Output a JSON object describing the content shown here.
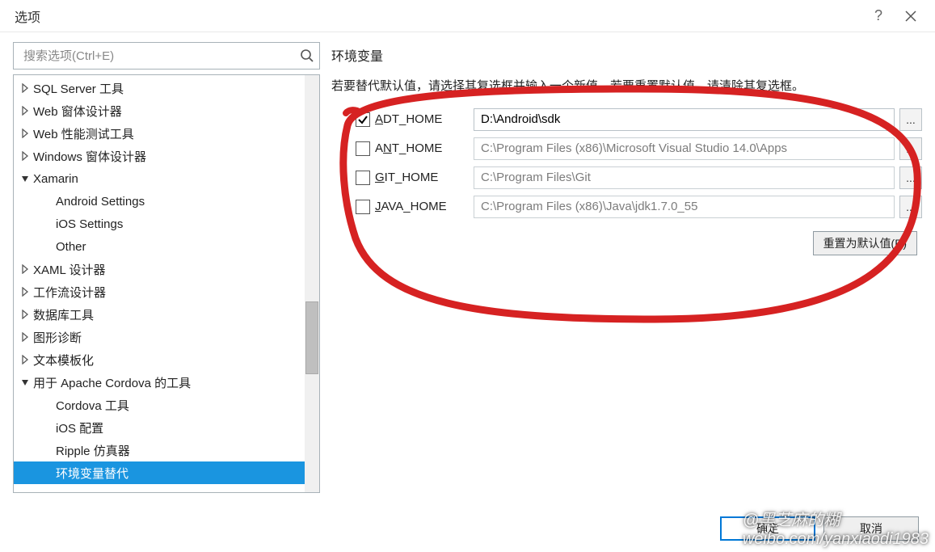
{
  "title": "选项",
  "search": {
    "placeholder": "搜索选项(Ctrl+E)"
  },
  "tree": {
    "items": [
      {
        "indent": 1,
        "arrow": "right",
        "label": "SQL Server 工具"
      },
      {
        "indent": 1,
        "arrow": "right",
        "label": "Web 窗体设计器"
      },
      {
        "indent": 1,
        "arrow": "right",
        "label": "Web 性能测试工具"
      },
      {
        "indent": 1,
        "arrow": "right",
        "label": "Windows 窗体设计器"
      },
      {
        "indent": 1,
        "arrow": "down",
        "label": "Xamarin"
      },
      {
        "indent": 2,
        "arrow": "",
        "label": "Android Settings"
      },
      {
        "indent": 2,
        "arrow": "",
        "label": "iOS Settings"
      },
      {
        "indent": 2,
        "arrow": "",
        "label": "Other"
      },
      {
        "indent": 1,
        "arrow": "right",
        "label": "XAML 设计器"
      },
      {
        "indent": 1,
        "arrow": "right",
        "label": "工作流设计器"
      },
      {
        "indent": 1,
        "arrow": "right",
        "label": "数据库工具"
      },
      {
        "indent": 1,
        "arrow": "right",
        "label": "图形诊断"
      },
      {
        "indent": 1,
        "arrow": "right",
        "label": "文本模板化"
      },
      {
        "indent": 1,
        "arrow": "down",
        "label": "用于 Apache Cordova 的工具"
      },
      {
        "indent": 2,
        "arrow": "",
        "label": "Cordova 工具"
      },
      {
        "indent": 2,
        "arrow": "",
        "label": "iOS 配置"
      },
      {
        "indent": 2,
        "arrow": "",
        "label": "Ripple 仿真器"
      },
      {
        "indent": 2,
        "arrow": "",
        "label": "环境变量替代",
        "selected": true
      }
    ]
  },
  "panel": {
    "title": "环境变量",
    "help": "若要替代默认值，请选择其复选框并输入一个新值。若要重置默认值，请清除其复选框。",
    "rows": [
      {
        "checked": true,
        "name_pre": "",
        "name_u": "A",
        "name_post": "DT_HOME",
        "value": "D:\\Android\\sdk",
        "dim": false
      },
      {
        "checked": false,
        "name_pre": "A",
        "name_u": "N",
        "name_post": "T_HOME",
        "value": "C:\\Program Files (x86)\\Microsoft Visual Studio 14.0\\Apps",
        "dim": true
      },
      {
        "checked": false,
        "name_pre": "",
        "name_u": "G",
        "name_post": "IT_HOME",
        "value": "C:\\Program Files\\Git",
        "dim": true
      },
      {
        "checked": false,
        "name_pre": "",
        "name_u": "J",
        "name_post": "AVA_HOME",
        "value": "C:\\Program Files (x86)\\Java\\jdk1.7.0_55",
        "dim": true
      }
    ],
    "browse": "...",
    "reset": "重置为默认值(R)"
  },
  "footer": {
    "ok": "确定",
    "cancel": "取消"
  },
  "watermark": {
    "handle": "@黑芝麻的糊",
    "url": "weibo.com/yanxiaodi1983"
  }
}
